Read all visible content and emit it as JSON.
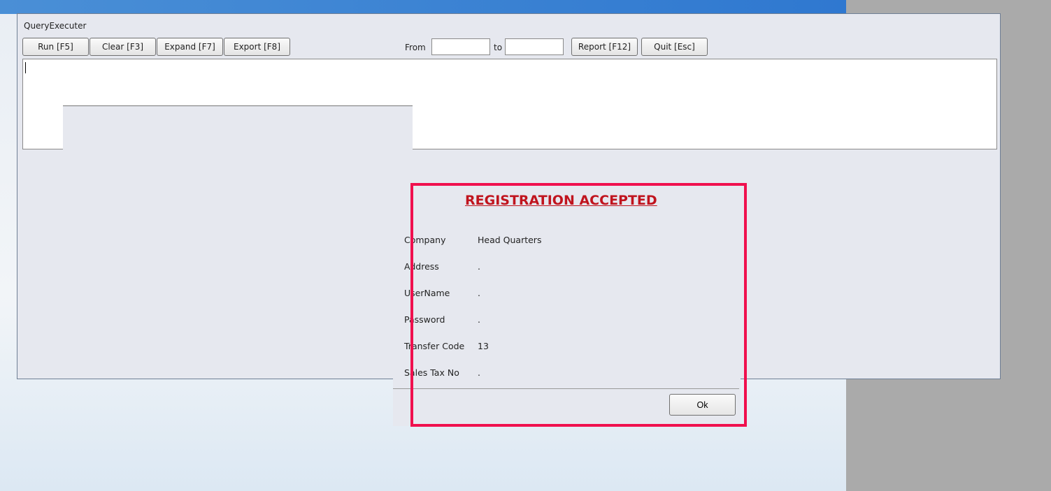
{
  "window": {
    "title": "QueryExecuter"
  },
  "toolbar": {
    "run": "Run [F5]",
    "clear": "Clear [F3]",
    "expand": "Expand [F7]",
    "export": "Export [F8]",
    "from_label": "From",
    "from_value": "",
    "to_label": "to",
    "to_value": "",
    "report": "Report [F12]",
    "quit": "Quit [Esc]"
  },
  "editor": {
    "value": ""
  },
  "dialog": {
    "title": "REGISTRATION ACCEPTED",
    "fields": [
      {
        "label": "Company",
        "value": "Head Quarters"
      },
      {
        "label": "Address",
        "value": "."
      },
      {
        "label": "UserName",
        "value": "."
      },
      {
        "label": "Password",
        "value": "."
      },
      {
        "label": "Transfer Code",
        "value": "13"
      },
      {
        "label": "Sales Tax No",
        "value": "."
      }
    ],
    "ok": "Ok"
  },
  "colors": {
    "highlight": "#f0104e",
    "title_red": "#c0141e"
  }
}
